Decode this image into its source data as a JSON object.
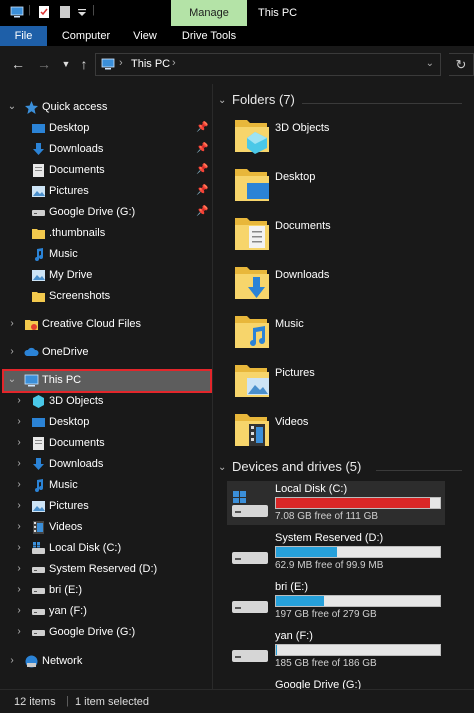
{
  "titlebar": {
    "manage_label": "Manage",
    "window_title": "This PC"
  },
  "ribbon": {
    "file": "File",
    "computer": "Computer",
    "view": "View",
    "drive_tools": "Drive Tools"
  },
  "address": {
    "crumb": "This PC"
  },
  "nav": {
    "quick_access": "Quick access",
    "quick_items": [
      "Desktop",
      "Downloads",
      "Documents",
      "Pictures",
      "Google Drive (G:)",
      ".thumbnails",
      "Music",
      "My Drive",
      "Screenshots"
    ],
    "creative_cloud": "Creative Cloud Files",
    "onedrive": "OneDrive",
    "this_pc": "This PC",
    "pc_items": [
      "3D Objects",
      "Desktop",
      "Documents",
      "Downloads",
      "Music",
      "Pictures",
      "Videos",
      "Local Disk (C:)",
      "System Reserved (D:)",
      "bri (E:)",
      "yan (F:)",
      "Google Drive (G:)"
    ],
    "network": "Network"
  },
  "content": {
    "folders_header": "Folders (7)",
    "folders": [
      "3D Objects",
      "Desktop",
      "Documents",
      "Downloads",
      "Music",
      "Pictures",
      "Videos"
    ],
    "drives_header": "Devices and drives (5)",
    "drives": [
      {
        "name": "Local Disk (C:)",
        "free": "7.08 GB free of 111 GB",
        "used_fraction": 0.936,
        "color": "#da2626"
      },
      {
        "name": "System Reserved (D:)",
        "free": "62.9 MB free of 99.9 MB",
        "used_fraction": 0.37,
        "color": "#26a0da"
      },
      {
        "name": "bri (E:)",
        "free": "197 GB free of 279 GB",
        "used_fraction": 0.294,
        "color": "#26a0da"
      },
      {
        "name": "yan (F:)",
        "free": "185 GB free of 186 GB",
        "used_fraction": 0.006,
        "color": "#26a0da"
      },
      {
        "name": "Google Drive (G:)",
        "free": "",
        "used_fraction": 0,
        "color": "#26a0da"
      }
    ]
  },
  "status": {
    "items": "12 items",
    "selected": "1 item selected"
  },
  "colors": {
    "background": "#191919",
    "selection_outline": "#e3262b",
    "manage_tab": "#b4e3a7",
    "file_tab": "#1e5fa8",
    "accent_blue": "#26a0da",
    "warning_red": "#da2626"
  }
}
